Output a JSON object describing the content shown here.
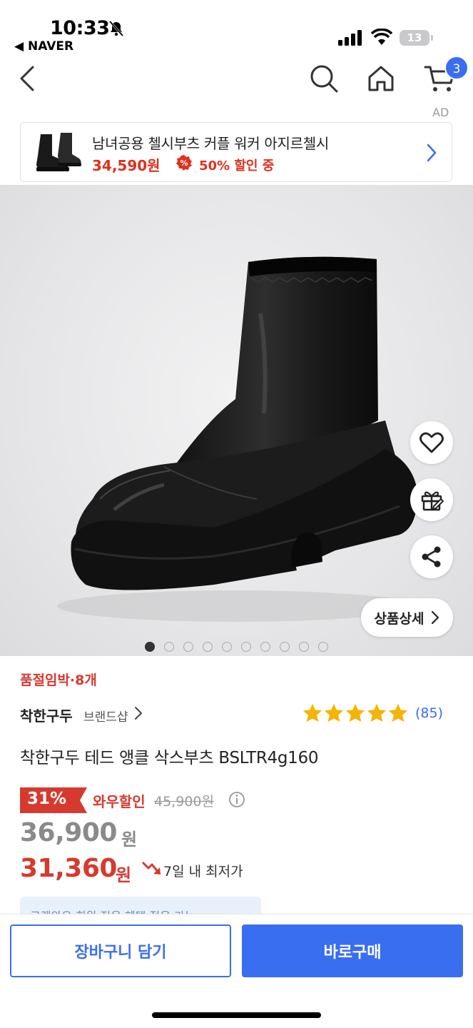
{
  "status_bar": {
    "time": "10:33",
    "back_app": "◀ NAVER",
    "battery": "13"
  },
  "nav": {
    "cart_count": "3",
    "ad_label": "AD"
  },
  "ad": {
    "title": "남녀공용 첼시부츠 커플 워커 아지르첼시",
    "price": "34,590원",
    "discount": "50% 할인 중"
  },
  "gallery": {
    "detail_button": "상품상세",
    "dot_count": 10,
    "active_index": 0
  },
  "product": {
    "stock_notice": "품절임박·8개",
    "brand": "착한구두",
    "brand_shop": "브랜드샵",
    "rating_stars": 5,
    "review_count": "(85)",
    "title": "착한구두 테드 앵클 삭스부츠 BSLTR4g160",
    "discount_rate": "31%",
    "discount_label": "와우할인",
    "original_price": "45,900원",
    "price": "36,900",
    "price_unit": "원",
    "sale_price": "31,360",
    "sale_unit": "원",
    "lowest_text": "7일 내 최저가",
    "benefit_peek": "로켓와우 회원 전용 혜택 적용 가능"
  },
  "actions": {
    "add_to_cart": "장바구니 담기",
    "buy_now": "바로구매"
  },
  "colors": {
    "accent": "#3a6ef0",
    "sale": "#d63a2f",
    "star": "#f6b300"
  }
}
